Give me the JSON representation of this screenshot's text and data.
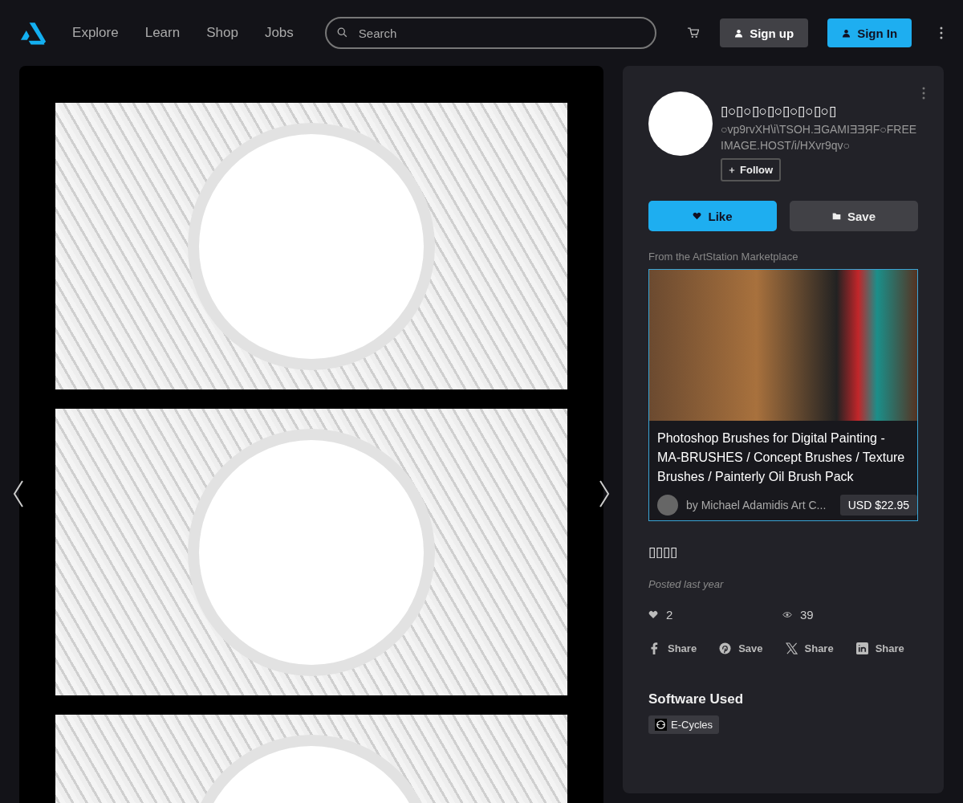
{
  "nav": {
    "links": [
      "Explore",
      "Learn",
      "Shop",
      "Jobs"
    ],
    "search": {
      "placeholder": "Search"
    },
    "buttons": [
      {
        "label": "Sign up",
        "kind": "secondary"
      },
      {
        "label": "Sign In",
        "kind": "primary"
      }
    ]
  },
  "gallery": {
    "images": [
      {
        "kind": "artwork"
      },
      {
        "kind": "artwork"
      },
      {
        "kind": "artwork"
      }
    ]
  },
  "artist": {
    "name": "▯○▯○▯○▯○▯○▯○▯○▯",
    "headline": "○vp9rvXH\\i\\TSOH.ƎGAMIƎƎЯF○FREEIMAGE.HOST/i/HXvr9qv○",
    "follow": "Follow"
  },
  "actions": [
    {
      "label": "Like",
      "kind": "primary"
    },
    {
      "label": "Save",
      "kind": "secondary"
    }
  ],
  "marketplace": {
    "heading": "From the ArtStation Marketplace",
    "title": "Photoshop Brushes for Digital Painting - MA-BRUSHES / Concept Brushes / Texture Brushes / Painterly Oil Brush Pack",
    "author": "by Michael Adamidis Art C...",
    "price": "USD $22.95"
  },
  "tags": "▯▯▯▯",
  "posted": "Posted last year",
  "stats": [
    {
      "kind": "likes",
      "value": "2"
    },
    {
      "kind": "views",
      "value": "39"
    }
  ],
  "share": [
    {
      "kind": "facebook",
      "label": "Share"
    },
    {
      "kind": "pinterest",
      "label": "Save"
    },
    {
      "kind": "x",
      "label": "Share"
    },
    {
      "kind": "linkedin",
      "label": "Share"
    }
  ],
  "software": {
    "heading": "Software Used",
    "items": [
      "E-Cycles"
    ]
  }
}
